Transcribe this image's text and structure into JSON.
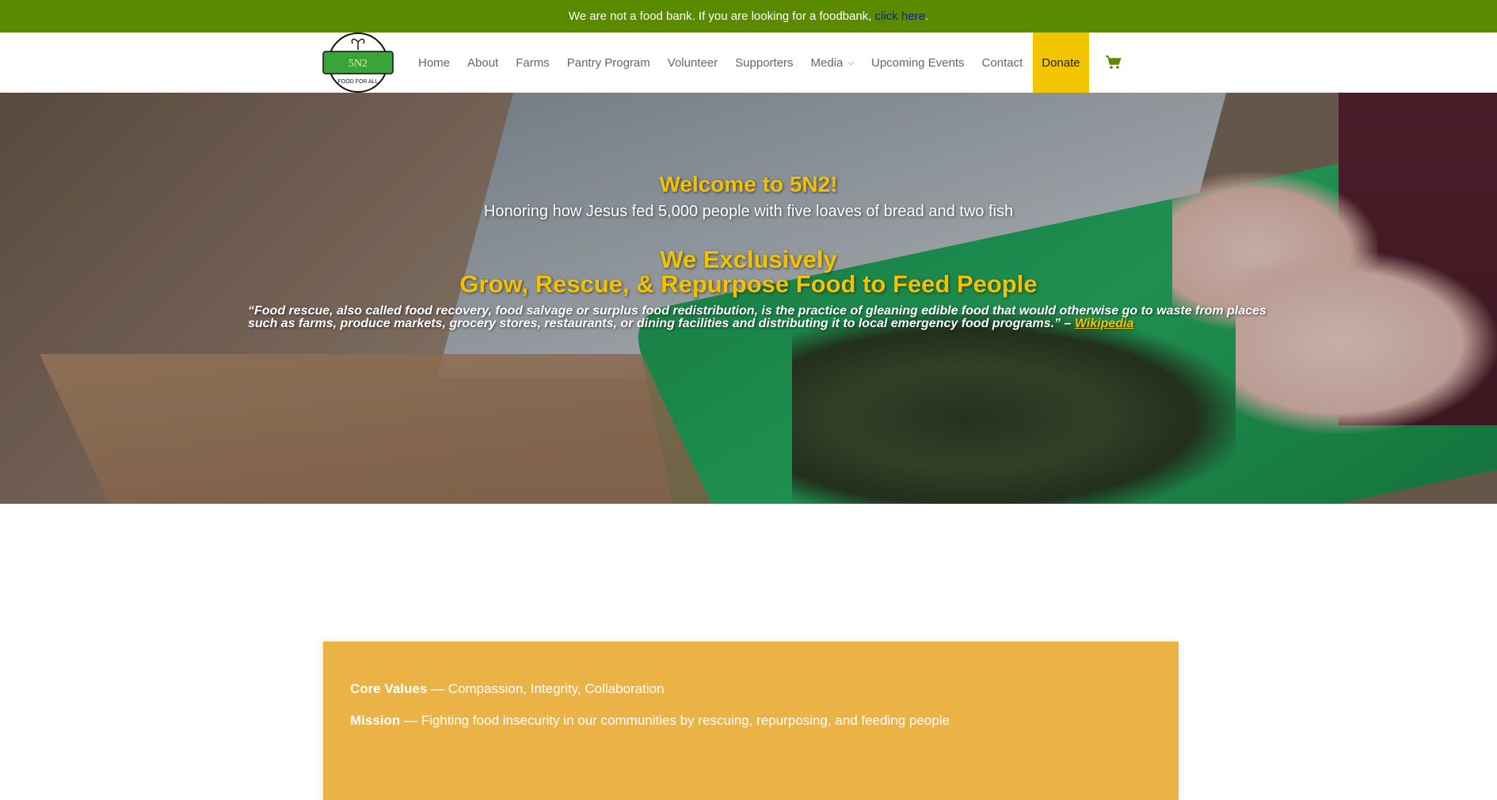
{
  "notice": {
    "text": "We are not a food bank. If you are looking for a foodbank,",
    "link": "click here",
    "suffix": "."
  },
  "logo": {
    "name": "5N2",
    "tagline": "FOOD FOR ALL"
  },
  "nav": {
    "items": [
      {
        "label": "Home"
      },
      {
        "label": "About"
      },
      {
        "label": "Farms"
      },
      {
        "label": "Pantry Program"
      },
      {
        "label": "Volunteer"
      },
      {
        "label": "Supporters"
      },
      {
        "label": "Media",
        "has_dropdown": true
      },
      {
        "label": "Upcoming Events"
      },
      {
        "label": "Contact"
      }
    ],
    "donate_label": "Donate",
    "cart_icon": "shopping-cart-icon"
  },
  "hero": {
    "title": "Welcome to 5N2!",
    "subtitle": "Honoring how Jesus fed 5,000 people with five loaves of bread and two fish",
    "heading_line1": "We Exclusively",
    "heading_line2": "Grow, Rescue, & Repurpose Food to Feed People",
    "quote": "“Food rescue, also called food recovery, food salvage or surplus food redistribution, is the practice of gleaning edible food that would otherwise go to waste from places such as farms, produce markets, grocery stores, restaurants, or dining facilities and distributing it to local emergency food programs.” –",
    "quote_source": "Wikipedia"
  },
  "values": {
    "core_label": "Core Values",
    "core_text": "— Compassion, Integrity, Collaboration",
    "mission_label": "Mission",
    "mission_text": "— Fighting food insecurity in our communities by rescuing, repurposing, and feeding people"
  },
  "colors": {
    "topbar": "#5a8a00",
    "accent_yellow": "#f2c200",
    "donate_bg": "#f3c400",
    "card_bg": "#ebb345",
    "logo_green": "#3aa33a"
  }
}
